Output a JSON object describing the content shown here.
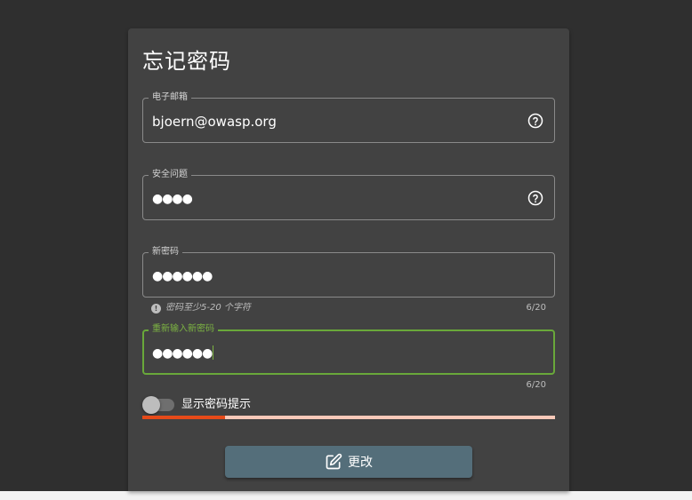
{
  "page": {
    "title": "忘记密码"
  },
  "form": {
    "email": {
      "label": "电子邮箱",
      "value": "bjoern@owasp.org",
      "help_icon": "question-circle-icon"
    },
    "security_answer": {
      "label": "安全问题",
      "value": "●●●●",
      "help_icon": "question-circle-icon"
    },
    "new_password": {
      "label": "新密码",
      "value": "●●●●●●",
      "hint": "密码至少5-20 个字符",
      "counter": "6/20"
    },
    "repeat_password": {
      "label": "重新输入新密码",
      "value": "●●●●●●",
      "counter": "6/20"
    },
    "show_hint": {
      "label": "显示密码提示",
      "checked": false
    },
    "strength": {
      "level": 0.2,
      "fill_color": "#e64a19",
      "track_color": "#f9c9b9"
    },
    "submit": {
      "label": "更改",
      "icon": "edit-icon"
    }
  },
  "colors": {
    "accent": "#7cb342",
    "button": "#546e7a",
    "card": "#424242",
    "background": "#2f2f2f"
  }
}
